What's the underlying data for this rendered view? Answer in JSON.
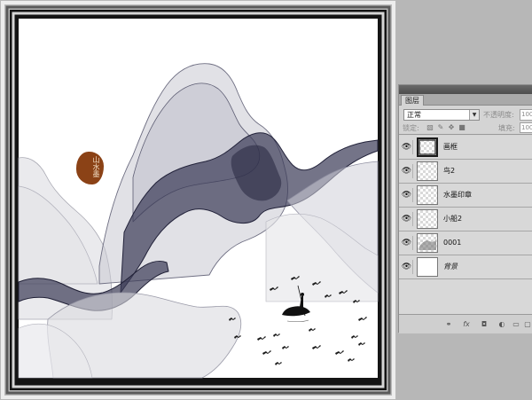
{
  "artwork": {
    "seal_text": [
      "山",
      "水",
      "墨"
    ]
  },
  "layers_panel": {
    "tab_label": "图层",
    "blend_mode": "正常",
    "opacity_label": "不透明度:",
    "opacity_value": "100%",
    "lock_label": "锁定:",
    "fill_label": "填充:",
    "fill_value": "100%",
    "layers": [
      {
        "name": "画框",
        "visible": true,
        "selected": true
      },
      {
        "name": "鸟2",
        "visible": true,
        "selected": false
      },
      {
        "name": "水墨印章",
        "visible": true,
        "selected": false
      },
      {
        "name": "小船2",
        "visible": true,
        "selected": false
      },
      {
        "name": "0001",
        "visible": true,
        "selected": false
      },
      {
        "name": "背景",
        "visible": true,
        "selected": false
      }
    ],
    "footer_icons": [
      "link-icon",
      "fx-icon",
      "mask-icon",
      "adjustment-icon",
      "group-icon",
      "new-layer-icon"
    ]
  },
  "colors": {
    "seal": "#8b4216",
    "ink": "#2d2d45",
    "panel_bg": "#d4d4d4",
    "workspace": "#b7b7b7"
  }
}
